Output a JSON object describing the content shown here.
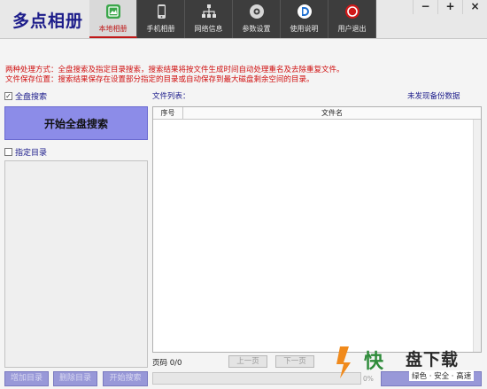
{
  "app": {
    "title": "多点相册"
  },
  "tabs": [
    {
      "label": "本地相册",
      "icon": "image-icon",
      "active": true
    },
    {
      "label": "手机相册",
      "icon": "phone-icon",
      "active": false
    },
    {
      "label": "网络信息",
      "icon": "network-icon",
      "active": false
    },
    {
      "label": "参数设置",
      "icon": "gear-icon",
      "active": false
    },
    {
      "label": "使用说明",
      "icon": "help-d-icon",
      "active": false
    },
    {
      "label": "用户退出",
      "icon": "exit-icon",
      "active": false
    }
  ],
  "window_controls": {
    "minimize": "−",
    "maximize": "+",
    "close": "×"
  },
  "info": {
    "line1": "两种处理方式：全盘搜索及指定目录搜索，搜索结果将按文件生成时间自动处理重名及去除重复文件。",
    "line2": "文件保存位置：搜索结果保存在设置部分指定的目录或自动保存到最大磁盘剩余空间的目录。"
  },
  "left": {
    "full_search_label": "全盘搜索",
    "full_search_checked": true,
    "start_button": "开始全盘搜索",
    "specify_dir_label": "指定目录",
    "specify_dir_checked": false,
    "add_dir": "增加目录",
    "delete_dir": "删除目录",
    "start_search": "开始搜索"
  },
  "right": {
    "file_list_label": "文件列表：",
    "no_backup": "未发现备份数据",
    "col_no": "序号",
    "col_name": "文件名",
    "page_info": "页码 0/0",
    "prev_page": "上一页",
    "next_page": "下一页",
    "progress_percent": 0,
    "progress_text": "0%",
    "display_button": "显示文件"
  },
  "watermark": {
    "brand": "盘下载",
    "kuai": "快",
    "slogan": "绿色 · 安全 · 高速"
  },
  "colors": {
    "accent_red": "#d01010",
    "button_purple": "#8c8ce8",
    "tab_dark": "#3d3d3d",
    "title_blue": "#1c1c8a"
  }
}
